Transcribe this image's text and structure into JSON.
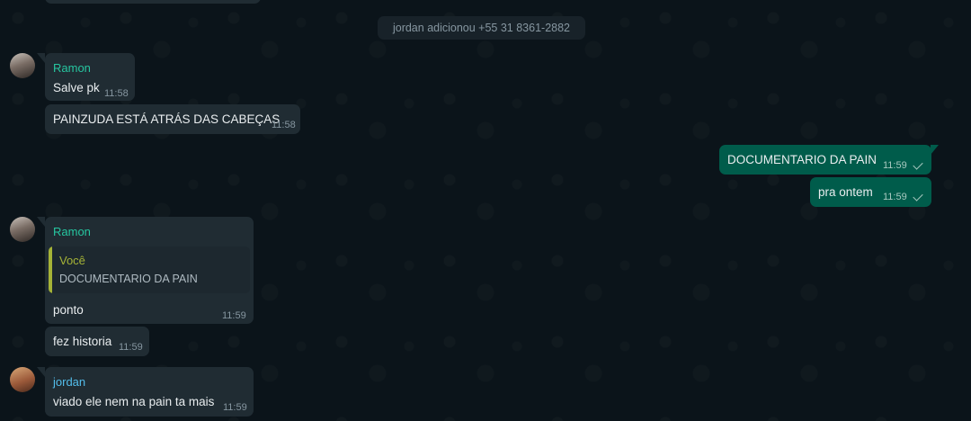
{
  "system_message": "jordan adicionou +55 31 8361-2882",
  "messages": [
    {
      "sender": "Ramon",
      "text": "Salve pk",
      "time": "11:58"
    },
    {
      "text": "PAINZUDA ESTÁ ATRÁS DAS CABEÇAS",
      "time": "11:58"
    },
    {
      "text": "DOCUMENTARIO DA PAIN",
      "time": "11:59"
    },
    {
      "text": "pra ontem",
      "time": "11:59"
    },
    {
      "sender": "Ramon",
      "quote": {
        "author": "Você",
        "text": "DOCUMENTARIO DA PAIN"
      },
      "text": "ponto",
      "time": "11:59"
    },
    {
      "text": "fez historia",
      "time": "11:59"
    },
    {
      "sender": "jordan",
      "text": "viado ele nem na pain ta mais",
      "time": "11:59"
    }
  ]
}
